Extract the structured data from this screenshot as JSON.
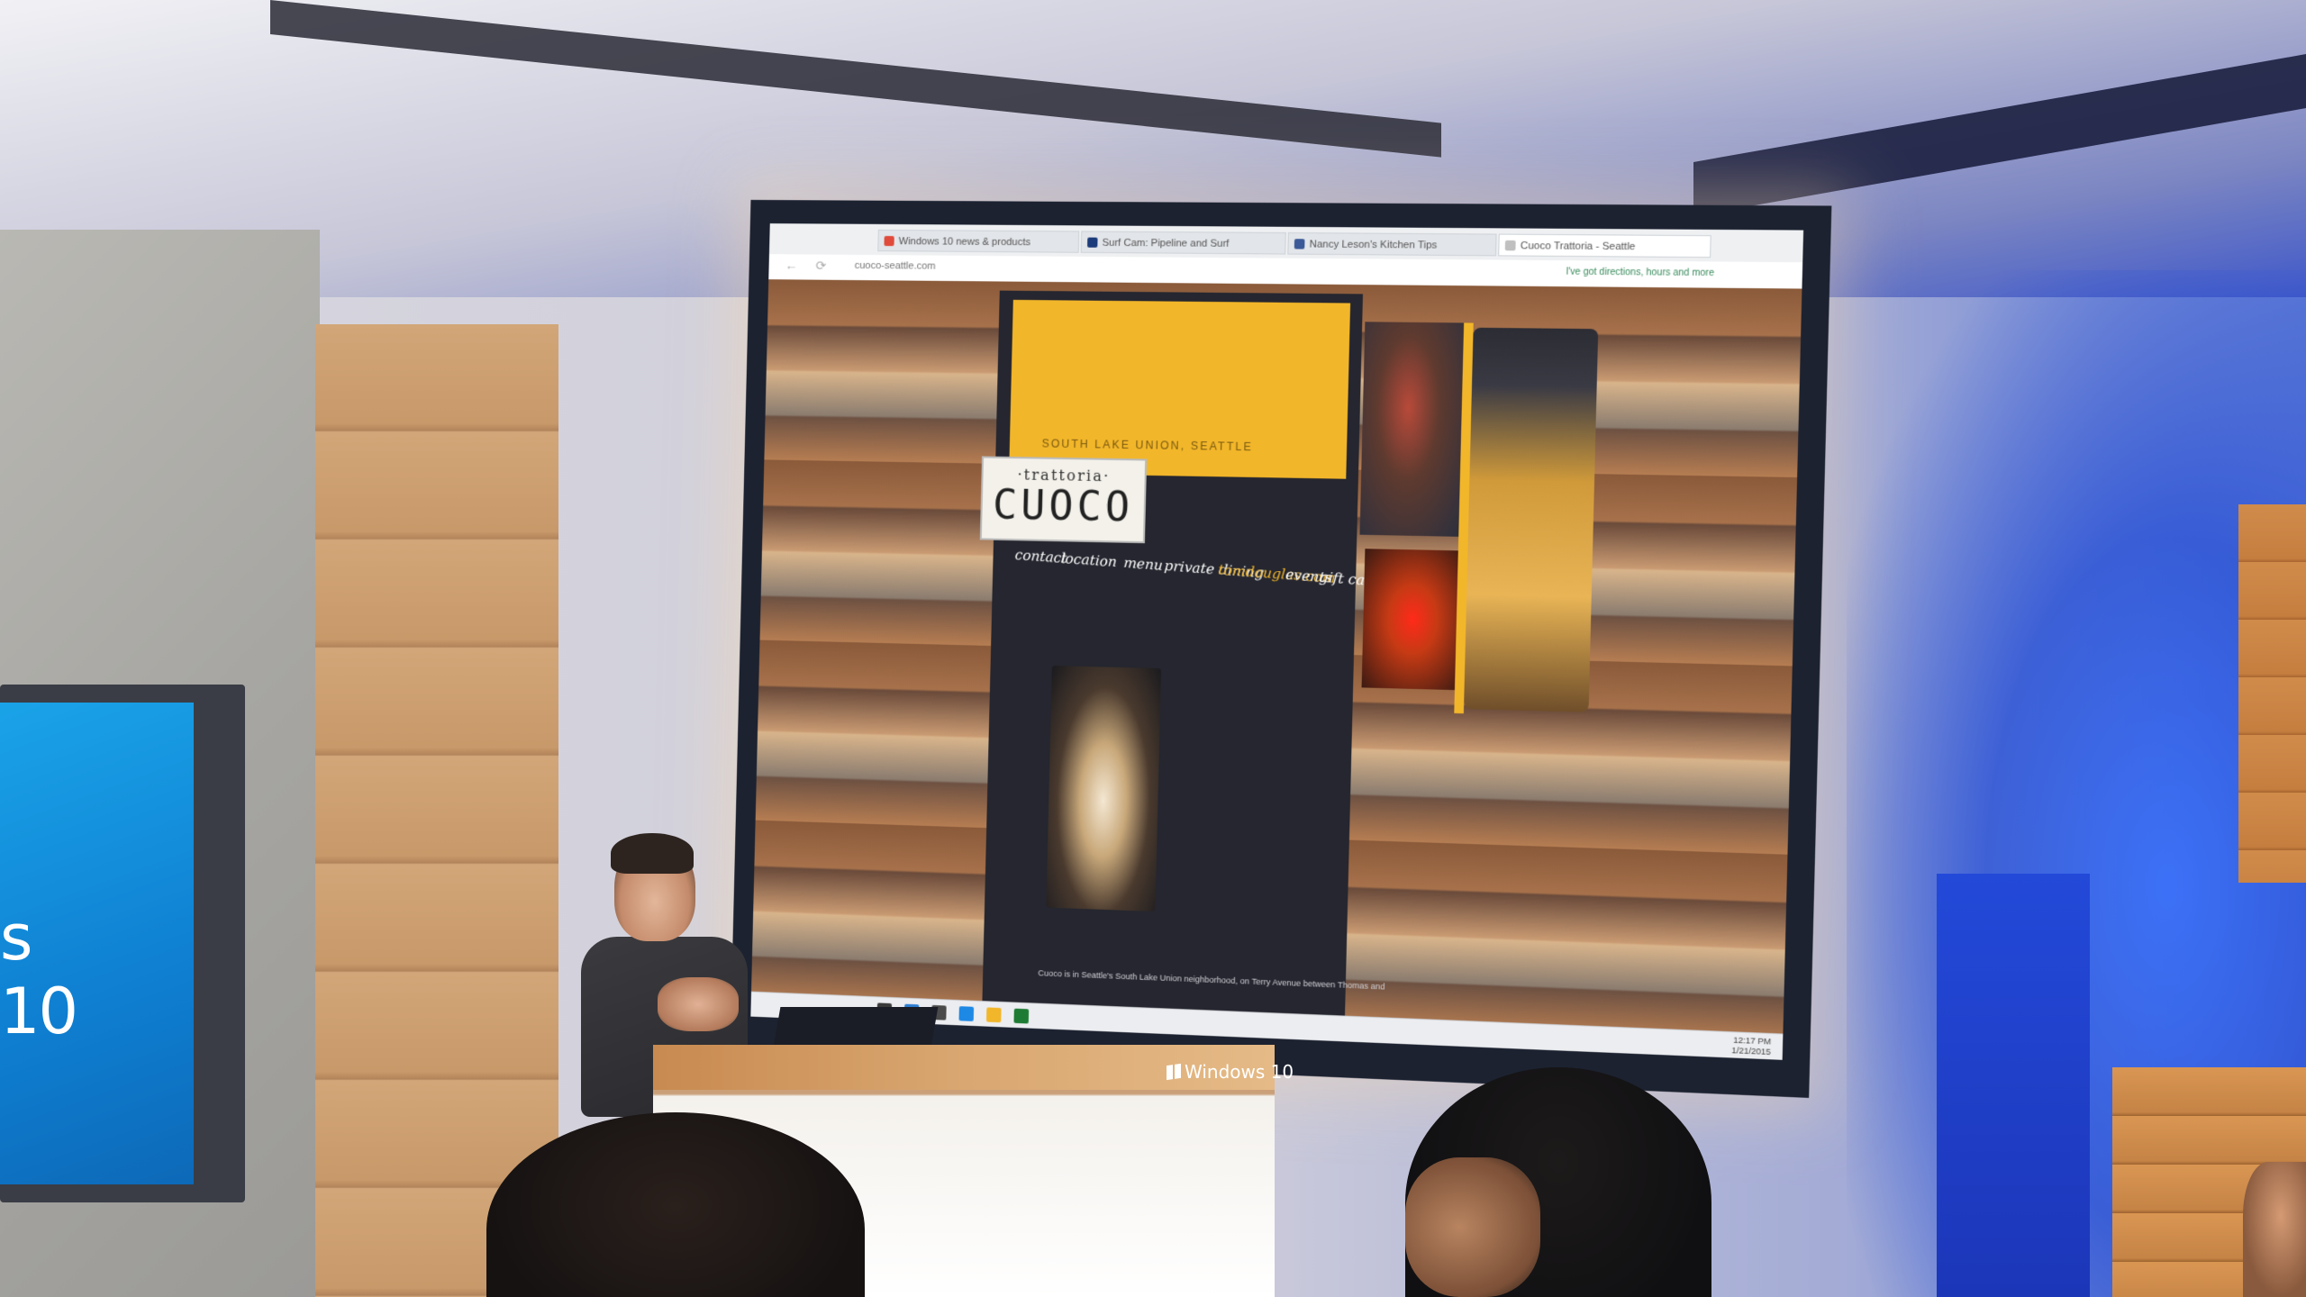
{
  "left_monitor": {
    "text": "s 10"
  },
  "browser": {
    "tabs": [
      {
        "label": "Windows 10 news & products",
        "icon_color": "#e04a3a"
      },
      {
        "label": "Surf Cam: Pipeline and Surf",
        "icon_color": "#1c3b7a"
      },
      {
        "label": "Nancy Leson's Kitchen Tips",
        "icon_color": "#3b5998"
      },
      {
        "label": "Cuoco Trattoria - Seattle",
        "icon_color": "#c0c0c0"
      }
    ],
    "url": "cuoco-seattle.com",
    "address_right": "I've got directions, hours and more",
    "nav_back_glyph": "←",
    "nav_refresh_glyph": "⟳"
  },
  "site": {
    "location": "SOUTH LAKE UNION, SEATTLE",
    "logo_small": "·trattoria·",
    "logo_big": "CUOCO",
    "nav": [
      "contact",
      "location",
      "menu",
      "private dining",
      "tomdouglas.com",
      "events",
      "gift cards"
    ],
    "nav_highlight_color": "#f2b62a",
    "footer": "Cuoco is in Seattle's South Lake Union neighborhood, on Terry Avenue between Thomas and"
  },
  "taskbar": {
    "icon_colors": [
      "#3a3a3a",
      "#2d7dd2",
      "#4a4a4a",
      "#1e88e5",
      "#f2b62a",
      "#1e7b34"
    ],
    "clock_time": "12:17 PM",
    "clock_date": "1/21/2015"
  },
  "podium": {
    "logo_text": "Windows 10"
  }
}
